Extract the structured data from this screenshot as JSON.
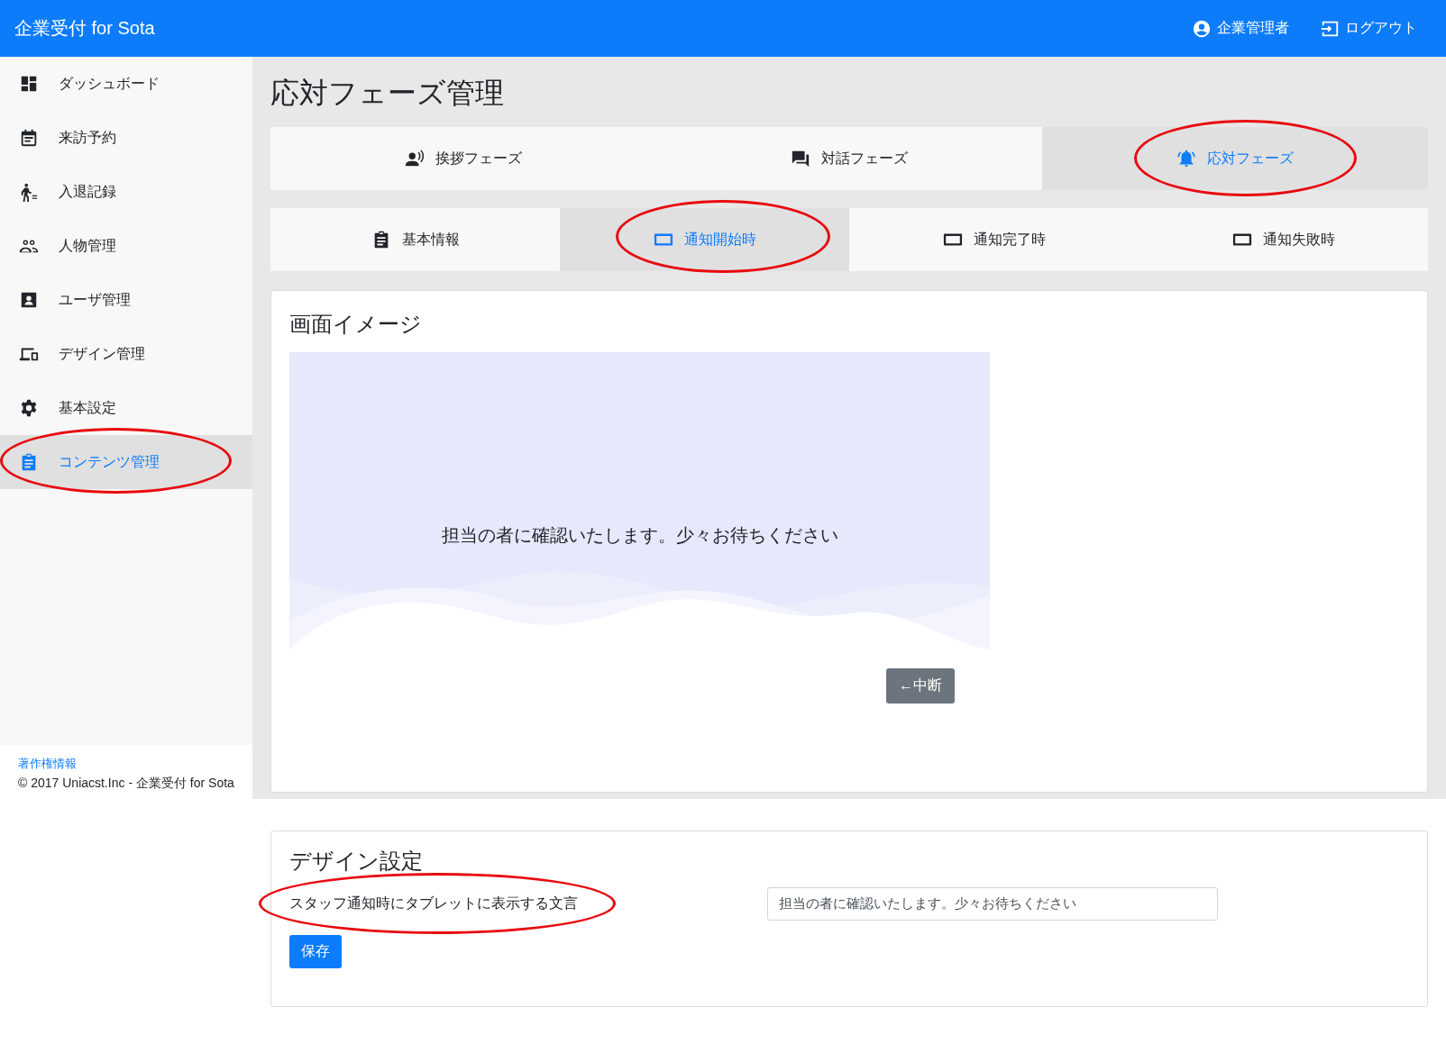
{
  "header": {
    "brand": "企業受付 for Sota",
    "user": "企業管理者",
    "logout": "ログアウト"
  },
  "sidebar": {
    "items": [
      {
        "label": "ダッシュボード",
        "kind": "dashboard",
        "selected": false,
        "circled": false
      },
      {
        "label": "来訪予約",
        "kind": "calendar",
        "selected": false,
        "circled": false
      },
      {
        "label": "入退記録",
        "kind": "walker",
        "selected": false,
        "circled": false
      },
      {
        "label": "人物管理",
        "kind": "people",
        "selected": false,
        "circled": false
      },
      {
        "label": "ユーザ管理",
        "kind": "contact",
        "selected": false,
        "circled": false
      },
      {
        "label": "デザイン管理",
        "kind": "devices",
        "selected": false,
        "circled": false
      },
      {
        "label": "基本設定",
        "kind": "gear",
        "selected": false,
        "circled": false
      },
      {
        "label": "コンテンツ管理",
        "kind": "clipboard",
        "selected": true,
        "circled": true
      }
    ],
    "footer": {
      "link": "著作権情報",
      "copyright": "© 2017 Uniacst.Inc - 企業受付 for Sota"
    }
  },
  "page_title": "応対フェーズ管理",
  "phase_tabs": [
    {
      "label": "挨拶フェーズ",
      "kind": "speaker",
      "selected": false,
      "circled": false
    },
    {
      "label": "対話フェーズ",
      "kind": "chat",
      "selected": false,
      "circled": false
    },
    {
      "label": "応対フェーズ",
      "kind": "bell",
      "selected": true,
      "circled": true
    }
  ],
  "sub_tabs": [
    {
      "label": "基本情報",
      "kind": "clipboard",
      "selected": false,
      "circled": false
    },
    {
      "label": "通知開始時",
      "kind": "tablet",
      "selected": true,
      "circled": true
    },
    {
      "label": "通知完了時",
      "kind": "tablet",
      "selected": false,
      "circled": false
    },
    {
      "label": "通知失敗時",
      "kind": "tablet",
      "selected": false,
      "circled": false
    }
  ],
  "preview_card": {
    "title": "画面イメージ",
    "message": "担当の者に確認いたします。少々お待ちください",
    "button": "←中断"
  },
  "design_card": {
    "title": "デザイン設定",
    "field_label": "スタッフ通知時にタブレットに表示する文言",
    "label_circled": true,
    "field_value": "担当の者に確認いたします。少々お待ちください",
    "save_button": "保存"
  }
}
